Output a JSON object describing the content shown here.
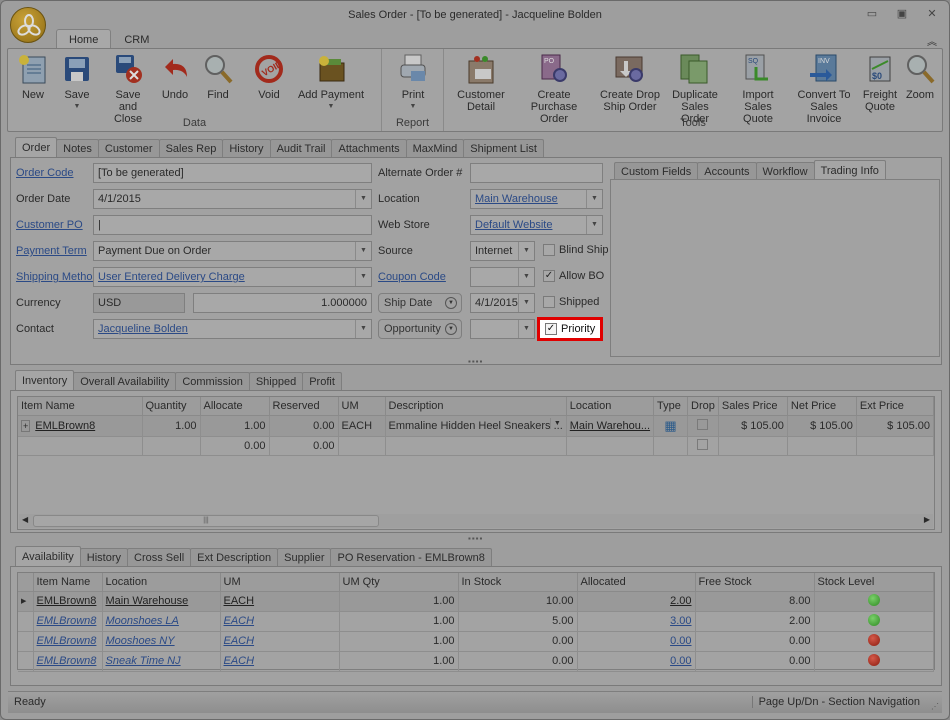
{
  "window": {
    "title": "Sales Order - [To be generated] - Jacqueline Bolden"
  },
  "ribbon": {
    "tabs": [
      {
        "label": "Home",
        "active": true
      },
      {
        "label": "CRM",
        "active": false
      }
    ],
    "groups": [
      {
        "label": "Data",
        "buttons": [
          "New",
          "Save",
          "Save and Close",
          "Undo",
          "Find",
          "Void",
          "Add Payment"
        ]
      },
      {
        "label": "Report",
        "buttons": [
          "Print"
        ]
      },
      {
        "label": "Tools",
        "buttons": [
          "Customer Detail",
          "Create Purchase Order",
          "Create Drop Ship Order",
          "Duplicate Sales Order",
          "Import Sales Quote",
          "Convert To Sales Invoice",
          "Freight Quote",
          "Zoom"
        ]
      }
    ],
    "labels": {
      "new": "New",
      "save": "Save",
      "save_close_1": "Save and",
      "save_close_2": "Close",
      "undo": "Undo",
      "find": "Find",
      "void": "Void",
      "add_payment": "Add Payment",
      "print": "Print",
      "customer_detail_1": "Customer",
      "customer_detail_2": "Detail",
      "create_po_1": "Create",
      "create_po_2": "Purchase Order",
      "create_drop_1": "Create Drop",
      "create_drop_2": "Ship Order",
      "dup_1": "Duplicate",
      "dup_2": "Sales Order",
      "import_1": "Import",
      "import_2": "Sales Quote",
      "convert_1": "Convert To",
      "convert_2": "Sales Invoice",
      "freight_1": "Freight",
      "freight_2": "Quote",
      "zoom": "Zoom",
      "group_data": "Data",
      "group_report": "Report",
      "group_tools": "Tools"
    }
  },
  "order_tabs": [
    "Order",
    "Notes",
    "Customer",
    "Sales Rep",
    "History",
    "Audit Trail",
    "Attachments",
    "MaxMind",
    "Shipment List"
  ],
  "form": {
    "order_code": {
      "label": "Order Code",
      "value": "[To be generated]"
    },
    "order_date": {
      "label": "Order Date",
      "value": "4/1/2015"
    },
    "customer_po": {
      "label": "Customer PO",
      "value": ""
    },
    "payment_term": {
      "label": "Payment Term",
      "value": "Payment Due on Order"
    },
    "shipping_method": {
      "label": "Shipping Method",
      "value": "User Entered Delivery Charge"
    },
    "currency": {
      "label": "Currency",
      "value": "USD",
      "rate": "1.000000"
    },
    "contact": {
      "label": "Contact",
      "value": "Jacqueline Bolden"
    },
    "alternate_order": {
      "label": "Alternate Order #",
      "value": ""
    },
    "location": {
      "label": "Location",
      "value": "Main Warehouse"
    },
    "web_store": {
      "label": "Web Store",
      "value": "Default Website"
    },
    "source": {
      "label": "Source",
      "value": "Internet"
    },
    "coupon_code": {
      "label": "Coupon Code",
      "value": ""
    },
    "ship_date": {
      "label": "Ship Date",
      "value": "4/1/2015"
    },
    "opportunity": {
      "label": "Opportunity",
      "value": ""
    },
    "blind_ship": {
      "label": "Blind Ship",
      "checked": false
    },
    "allow_bo": {
      "label": "Allow BO",
      "checked": true
    },
    "shipped": {
      "label": "Shipped",
      "checked": false
    },
    "priority": {
      "label": "Priority",
      "checked": true
    }
  },
  "side_tabs": [
    "Custom Fields",
    "Accounts",
    "Workflow",
    "Trading Info"
  ],
  "inventory_tabs": [
    "Inventory",
    "Overall Availability",
    "Commission",
    "Shipped",
    "Profit"
  ],
  "inventory": {
    "columns": [
      "Item Name",
      "Quantity",
      "Allocate",
      "Reserved",
      "UM",
      "Description",
      "Location",
      "Type",
      "Drop",
      "Sales Price",
      "Net Price",
      "Ext Price"
    ],
    "rows": [
      {
        "item": "EMLBrown8",
        "quantity": "1.00",
        "allocate": "1.00",
        "reserved": "0.00",
        "um": "EACH",
        "description": "Emmaline Hidden Heel Sneakers ...",
        "location": "Main Warehou...",
        "sales_price": "$ 105.00",
        "net_price": "$ 105.00",
        "ext_price": "$ 105.00"
      },
      {
        "item": "",
        "quantity": "",
        "allocate": "0.00",
        "reserved": "0.00",
        "um": "",
        "description": "",
        "location": "",
        "sales_price": "",
        "net_price": "",
        "ext_price": ""
      }
    ]
  },
  "bottom_tabs": [
    "Availability",
    "History",
    "Cross Sell",
    "Ext Description",
    "Supplier",
    "PO Reservation - EMLBrown8"
  ],
  "availability": {
    "columns": [
      "Item Name",
      "Location",
      "UM",
      "UM Qty",
      "In Stock",
      "Allocated",
      "Free Stock",
      "Stock Level"
    ],
    "rows": [
      {
        "item": "EMLBrown8",
        "location": "Main Warehouse",
        "um": "EACH",
        "um_qty": "1.00",
        "in_stock": "10.00",
        "allocated": "2.00",
        "free_stock": "8.00",
        "level": "green"
      },
      {
        "item": "EMLBrown8",
        "location": "Moonshoes LA",
        "um": "EACH",
        "um_qty": "1.00",
        "in_stock": "5.00",
        "allocated": "3.00",
        "free_stock": "2.00",
        "level": "green"
      },
      {
        "item": "EMLBrown8",
        "location": "Mooshoes NY",
        "um": "EACH",
        "um_qty": "1.00",
        "in_stock": "0.00",
        "allocated": "0.00",
        "free_stock": "0.00",
        "level": "red"
      },
      {
        "item": "EMLBrown8",
        "location": "Sneak Time NJ",
        "um": "EACH",
        "um_qty": "1.00",
        "in_stock": "0.00",
        "allocated": "0.00",
        "free_stock": "0.00",
        "level": "red"
      }
    ]
  },
  "status": {
    "left": "Ready",
    "right": "Page Up/Dn - Section Navigation"
  },
  "colors": {
    "highlight_border": "#e00000",
    "link": "#2b4a86"
  }
}
